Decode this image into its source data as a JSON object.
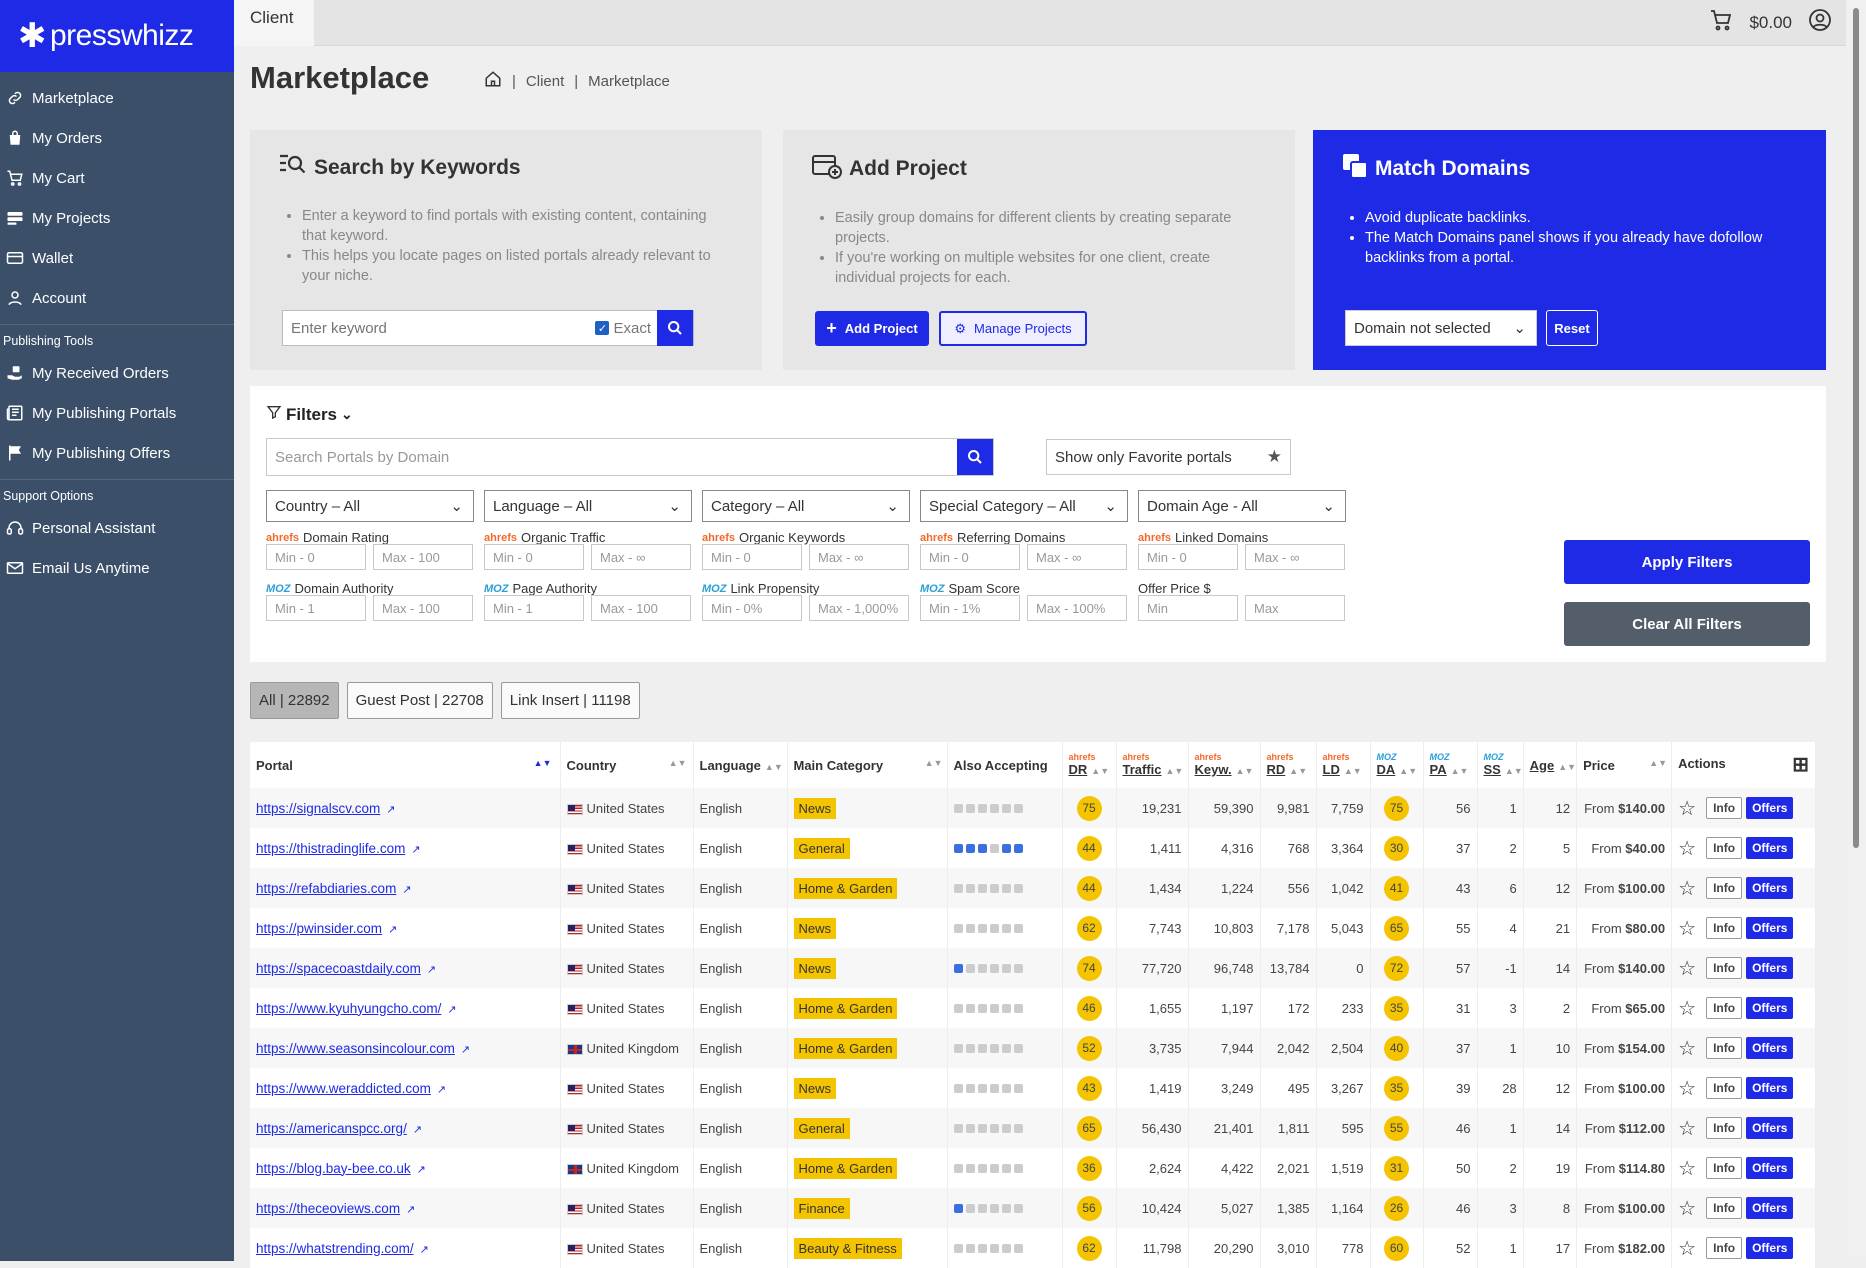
{
  "brand": {
    "name": "presswhizz"
  },
  "sidebar": {
    "items": [
      {
        "label": "Marketplace",
        "icon": "link-icon"
      },
      {
        "label": "My Orders",
        "icon": "bag-icon"
      },
      {
        "label": "My Cart",
        "icon": "cart-icon"
      },
      {
        "label": "My Projects",
        "icon": "projects-icon"
      },
      {
        "label": "Wallet",
        "icon": "wallet-icon"
      },
      {
        "label": "Account",
        "icon": "user-icon"
      }
    ],
    "section_publishing": "Publishing Tools",
    "publishing": [
      {
        "label": "My Received Orders",
        "icon": "hand-box-icon"
      },
      {
        "label": "My Publishing Portals",
        "icon": "newspaper-icon"
      },
      {
        "label": "My Publishing Offers",
        "icon": "flag-icon"
      }
    ],
    "section_support": "Support Options",
    "support": [
      {
        "label": "Personal Assistant",
        "icon": "headset-icon"
      },
      {
        "label": "Email Us Anytime",
        "icon": "mail-icon"
      }
    ]
  },
  "topbar": {
    "tab": "Client",
    "balance": "$0.00"
  },
  "page": {
    "title": "Marketplace",
    "breadcrumb": [
      "Client",
      "Marketplace"
    ]
  },
  "search_card": {
    "title": "Search by Keywords",
    "bullets": [
      "Enter a keyword to find portals with existing content, containing that keyword.",
      "This helps you locate pages on listed portals already relevant to your niche."
    ],
    "placeholder": "Enter keyword",
    "exact_label": "Exact"
  },
  "project_card": {
    "title": "Add Project",
    "bullets": [
      "Easily group domains for different clients by creating separate projects.",
      "If you're working on multiple websites for one client, create individual projects for each."
    ],
    "add_label": "Add Project",
    "manage_label": "Manage Projects"
  },
  "match_card": {
    "title": "Match Domains",
    "bullets": [
      "Avoid duplicate backlinks.",
      "The Match Domains panel shows if you already have dofollow backlinks from a portal."
    ],
    "select_value": "Domain not selected",
    "reset_label": "Reset"
  },
  "filters": {
    "title": "Filters",
    "domain_placeholder": "Search Portals by Domain",
    "favorites_label": "Show only Favorite portals",
    "selects": [
      "Country – All",
      "Language – All",
      "Category – All",
      "Special Category – All",
      "Domain Age - All"
    ],
    "ranges": [
      {
        "brand": "ahrefs",
        "label": "Domain Rating",
        "min": "Min - 0",
        "max": "Max - 100"
      },
      {
        "brand": "ahrefs",
        "label": "Organic Traffic",
        "min": "Min - 0",
        "max": "Max - ∞"
      },
      {
        "brand": "ahrefs",
        "label": "Organic Keywords",
        "min": "Min - 0",
        "max": "Max - ∞"
      },
      {
        "brand": "ahrefs",
        "label": "Referring Domains",
        "min": "Min - 0",
        "max": "Max - ∞"
      },
      {
        "brand": "ahrefs",
        "label": "Linked Domains",
        "min": "Min - 0",
        "max": "Max - ∞"
      },
      {
        "brand": "MOZ",
        "label": "Domain Authority",
        "min": "Min - 1",
        "max": "Max - 100"
      },
      {
        "brand": "MOZ",
        "label": "Page Authority",
        "min": "Min - 1",
        "max": "Max - 100"
      },
      {
        "brand": "MOZ",
        "label": "Link Propensity",
        "min": "Min - 0%",
        "max": "Max - 1,000%"
      },
      {
        "brand": "MOZ",
        "label": "Spam Score",
        "min": "Min - 1%",
        "max": "Max - 100%"
      },
      {
        "brand": "",
        "label": "Offer Price $",
        "min": "Min",
        "max": "Max"
      }
    ],
    "apply_label": "Apply Filters",
    "clear_label": "Clear All Filters"
  },
  "tabs": [
    "All | 22892",
    "Guest Post | 22708",
    "Link Insert | 11198"
  ],
  "table": {
    "headers": {
      "portal": "Portal",
      "country": "Country",
      "language": "Language",
      "category": "Main Category",
      "accepting": "Also Accepting",
      "dr": "DR",
      "traffic": "Traffic",
      "keyw": "Keyw.",
      "rd": "RD",
      "ld": "LD",
      "da": "DA",
      "pa": "PA",
      "ss": "SS",
      "age": "Age",
      "price": "Price",
      "actions": "Actions"
    },
    "brand_ahrefs": "ahrefs",
    "brand_moz": "MOZ",
    "info_label": "Info",
    "offers_label": "Offers",
    "price_prefix": "From",
    "rows": [
      {
        "portal": "https://signalscv.com",
        "flag": "us",
        "country": "United States",
        "language": "English",
        "category": "News",
        "acc": [
          0,
          0,
          0,
          0,
          0,
          0
        ],
        "dr": "75",
        "traffic": "19,231",
        "keyw": "59,390",
        "rd": "9,981",
        "ld": "7,759",
        "da": "75",
        "pa": "56",
        "ss": "1",
        "age": "12",
        "price": "$140.00"
      },
      {
        "portal": "https://thistradinglife.com",
        "flag": "us",
        "country": "United States",
        "language": "English",
        "category": "General",
        "acc": [
          1,
          1,
          1,
          0,
          1,
          1
        ],
        "dr": "44",
        "traffic": "1,411",
        "keyw": "4,316",
        "rd": "768",
        "ld": "3,364",
        "da": "30",
        "pa": "37",
        "ss": "2",
        "age": "5",
        "price": "$40.00"
      },
      {
        "portal": "https://refabdiaries.com",
        "flag": "us",
        "country": "United States",
        "language": "English",
        "category": "Home & Garden",
        "acc": [
          0,
          0,
          0,
          0,
          0,
          0
        ],
        "dr": "44",
        "traffic": "1,434",
        "keyw": "1,224",
        "rd": "556",
        "ld": "1,042",
        "da": "41",
        "pa": "43",
        "ss": "6",
        "age": "12",
        "price": "$100.00"
      },
      {
        "portal": "https://pwinsider.com",
        "flag": "us",
        "country": "United States",
        "language": "English",
        "category": "News",
        "acc": [
          0,
          0,
          0,
          0,
          0,
          0
        ],
        "dr": "62",
        "traffic": "7,743",
        "keyw": "10,803",
        "rd": "7,178",
        "ld": "5,043",
        "da": "65",
        "pa": "55",
        "ss": "4",
        "age": "21",
        "price": "$80.00"
      },
      {
        "portal": "https://spacecoastdaily.com",
        "flag": "us",
        "country": "United States",
        "language": "English",
        "category": "News",
        "acc": [
          1,
          0,
          0,
          0,
          0,
          0
        ],
        "dr": "74",
        "traffic": "77,720",
        "keyw": "96,748",
        "rd": "13,784",
        "ld": "0",
        "da": "72",
        "pa": "57",
        "ss": "-1",
        "age": "14",
        "price": "$140.00"
      },
      {
        "portal": "https://www.kyuhyungcho.com/",
        "flag": "us",
        "country": "United States",
        "language": "English",
        "category": "Home & Garden",
        "acc": [
          0,
          0,
          0,
          0,
          0,
          0
        ],
        "dr": "46",
        "traffic": "1,655",
        "keyw": "1,197",
        "rd": "172",
        "ld": "233",
        "da": "35",
        "pa": "31",
        "ss": "3",
        "age": "2",
        "price": "$65.00"
      },
      {
        "portal": "https://www.seasonsincolour.com",
        "flag": "uk",
        "country": "United Kingdom",
        "language": "English",
        "category": "Home & Garden",
        "acc": [
          0,
          0,
          0,
          0,
          0,
          0
        ],
        "dr": "52",
        "traffic": "3,735",
        "keyw": "7,944",
        "rd": "2,042",
        "ld": "2,504",
        "da": "40",
        "pa": "37",
        "ss": "1",
        "age": "10",
        "price": "$154.00"
      },
      {
        "portal": "https://www.weraddicted.com",
        "flag": "us",
        "country": "United States",
        "language": "English",
        "category": "News",
        "acc": [
          0,
          0,
          0,
          0,
          0,
          0
        ],
        "dr": "43",
        "traffic": "1,419",
        "keyw": "3,249",
        "rd": "495",
        "ld": "3,267",
        "da": "35",
        "pa": "39",
        "ss": "28",
        "age": "12",
        "price": "$100.00"
      },
      {
        "portal": "https://americanspcc.org/",
        "flag": "us",
        "country": "United States",
        "language": "English",
        "category": "General",
        "acc": [
          0,
          0,
          0,
          0,
          0,
          0
        ],
        "dr": "65",
        "traffic": "56,430",
        "keyw": "21,401",
        "rd": "1,811",
        "ld": "595",
        "da": "55",
        "pa": "46",
        "ss": "1",
        "age": "14",
        "price": "$112.00"
      },
      {
        "portal": "https://blog.bay-bee.co.uk",
        "flag": "uk",
        "country": "United Kingdom",
        "language": "English",
        "category": "Home & Garden",
        "acc": [
          0,
          0,
          0,
          0,
          0,
          0
        ],
        "dr": "36",
        "traffic": "2,624",
        "keyw": "4,422",
        "rd": "2,021",
        "ld": "1,519",
        "da": "31",
        "pa": "50",
        "ss": "2",
        "age": "19",
        "price": "$114.80"
      },
      {
        "portal": "https://theceoviews.com",
        "flag": "us",
        "country": "United States",
        "language": "English",
        "category": "Finance",
        "acc": [
          1,
          0,
          0,
          0,
          0,
          0
        ],
        "dr": "56",
        "traffic": "10,424",
        "keyw": "5,027",
        "rd": "1,385",
        "ld": "1,164",
        "da": "26",
        "pa": "46",
        "ss": "3",
        "age": "8",
        "price": "$100.00"
      },
      {
        "portal": "https://whatstrending.com/",
        "flag": "us",
        "country": "United States",
        "language": "English",
        "category": "Beauty & Fitness",
        "acc": [
          0,
          0,
          0,
          0,
          0,
          0
        ],
        "dr": "62",
        "traffic": "11,798",
        "keyw": "20,290",
        "rd": "3,010",
        "ld": "778",
        "da": "60",
        "pa": "52",
        "ss": "1",
        "age": "17",
        "price": "$182.00"
      }
    ]
  },
  "colors": {
    "accent": "#1f2ae6",
    "sidebar": "#3c4f69",
    "badge": "#f5c400"
  }
}
